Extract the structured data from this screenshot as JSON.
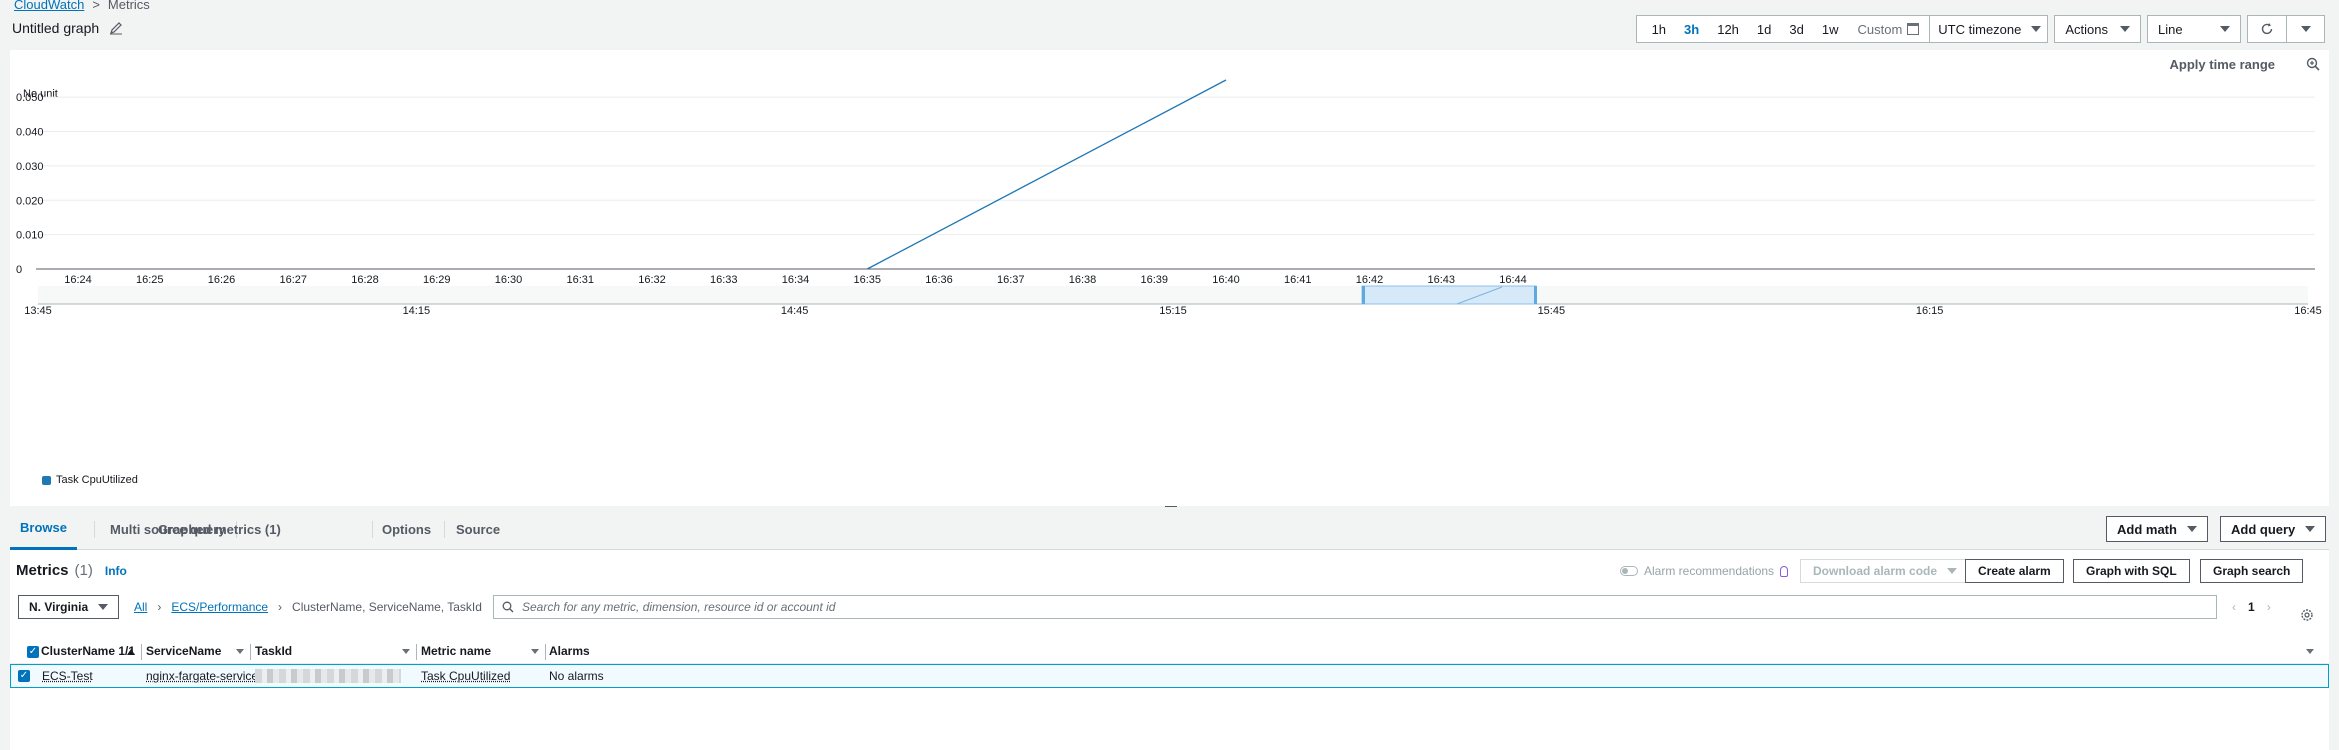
{
  "breadcrumb": {
    "root": "CloudWatch",
    "separator": ">",
    "current": "Metrics"
  },
  "graph": {
    "title": "Untitled graph"
  },
  "toolbar": {
    "ranges": [
      "1h",
      "3h",
      "12h",
      "1d",
      "3d",
      "1w"
    ],
    "active_range": "3h",
    "custom_label": "Custom",
    "timezone": "UTC timezone",
    "actions_label": "Actions",
    "chart_type": "Line"
  },
  "chart_panel": {
    "apply_time_range": "Apply time range"
  },
  "chart_data": {
    "type": "line",
    "ylabel": "No unit",
    "ylim": [
      0,
      0.055
    ],
    "yticks": [
      "0",
      "0.010",
      "0.020",
      "0.030",
      "0.040",
      "0.050"
    ],
    "ytick_values": [
      0,
      0.01,
      0.02,
      0.03,
      0.04,
      0.05
    ],
    "xticks": [
      "16:24",
      "16:25",
      "16:26",
      "16:27",
      "16:28",
      "16:29",
      "16:30",
      "16:31",
      "16:32",
      "16:33",
      "16:34",
      "16:35",
      "16:36",
      "16:37",
      "16:38",
      "16:39",
      "16:40",
      "16:41",
      "16:42",
      "16:43",
      "16:44"
    ],
    "series": [
      {
        "name": "Task CpuUtilized",
        "color": "#1f77b4",
        "x": [
          "16:35",
          "16:40"
        ],
        "values": [
          0,
          0.055
        ]
      }
    ],
    "overview_ticks": [
      "13:45",
      "14:15",
      "14:45",
      "15:15",
      "15:45",
      "16:15",
      "16:45"
    ],
    "legend_position": "bottom-left"
  },
  "tabs": [
    {
      "label": "Browse",
      "active": true
    },
    {
      "label": "Multi source query"
    },
    {
      "label": "Graphed metrics (1)"
    },
    {
      "label": "Options"
    },
    {
      "label": "Source"
    }
  ],
  "tab_actions": {
    "add_math": "Add math",
    "add_query": "Add query"
  },
  "metrics": {
    "title": "Metrics",
    "count": "(1)",
    "info": "Info",
    "alarm_recommendations": "Alarm recommendations",
    "download_alarm_code": "Download alarm code",
    "create_alarm": "Create alarm",
    "graph_with_sql": "Graph with SQL",
    "graph_search": "Graph search",
    "region": "N. Virginia",
    "path_all": "All",
    "path_namespace": "ECS/Performance",
    "path_dimensions": "ClusterName, ServiceName, TaskId",
    "search_placeholder": "Search for any metric, dimension, resource id or account id",
    "page": "1"
  },
  "table": {
    "columns": [
      "ClusterName 1/1",
      "ServiceName",
      "TaskId",
      "Metric name",
      "Alarms"
    ],
    "rows": [
      {
        "cluster": "ECS-Test",
        "service": "nginx-fargate-service",
        "metric": "Task CpuUtilized",
        "alarms": "No alarms"
      }
    ]
  }
}
